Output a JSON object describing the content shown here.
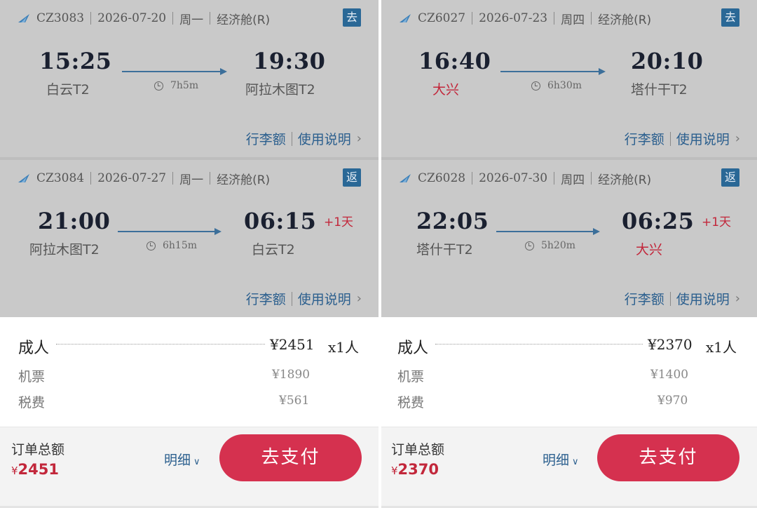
{
  "panels": [
    {
      "flights": [
        {
          "flight_no": "CZ3083",
          "date": "2026-07-20",
          "weekday": "周一",
          "cabin": "经济舱(R)",
          "badge": "去",
          "dep_time": "15:25",
          "dep_place": "白云T2",
          "duration": "7h5m",
          "arr_time": "19:30",
          "arr_place": "阿拉木图T2",
          "plus_day": "",
          "baggage_label": "行李额",
          "usage_label": "使用说明"
        },
        {
          "flight_no": "CZ3084",
          "date": "2026-07-27",
          "weekday": "周一",
          "cabin": "经济舱(R)",
          "badge": "返",
          "dep_time": "21:00",
          "dep_place": "阿拉木图T2",
          "duration": "6h15m",
          "arr_time": "06:15",
          "arr_place": "白云T2",
          "plus_day": "+1天",
          "baggage_label": "行李额",
          "usage_label": "使用说明"
        }
      ],
      "price": {
        "adult_label": "成人",
        "adult_price": "¥2451",
        "adult_count": "x1人",
        "ticket_label": "机票",
        "ticket_price": "¥1890",
        "tax_label": "税费",
        "tax_price": "¥561"
      },
      "bottom": {
        "total_label": "订单总额",
        "currency": "¥",
        "total_amount": "2451",
        "detail_label": "明细",
        "pay_label": "去支付"
      }
    },
    {
      "flights": [
        {
          "flight_no": "CZ6027",
          "date": "2026-07-23",
          "weekday": "周四",
          "cabin": "经济舱(R)",
          "badge": "去",
          "dep_time": "16:40",
          "dep_place": "大兴",
          "duration": "6h30m",
          "arr_time": "20:10",
          "arr_place": "塔什干T2",
          "plus_day": "",
          "baggage_label": "行李额",
          "usage_label": "使用说明"
        },
        {
          "flight_no": "CZ6028",
          "date": "2026-07-30",
          "weekday": "周四",
          "cabin": "经济舱(R)",
          "badge": "返",
          "dep_time": "22:05",
          "dep_place": "塔什干T2",
          "duration": "5h20m",
          "arr_time": "06:25",
          "arr_place": "大兴",
          "plus_day": "+1天",
          "baggage_label": "行李额",
          "usage_label": "使用说明"
        }
      ],
      "price": {
        "adult_label": "成人",
        "adult_price": "¥2370",
        "adult_count": "x1人",
        "ticket_label": "机票",
        "ticket_price": "¥1400",
        "tax_label": "税费",
        "tax_price": "¥970"
      },
      "bottom": {
        "total_label": "订单总额",
        "currency": "¥",
        "total_amount": "2370",
        "detail_label": "明细",
        "pay_label": "去支付"
      }
    }
  ],
  "colors": {
    "accent_blue": "#2b5f8e",
    "badge_blue": "#2a6896",
    "highlight_red": "#c2273b",
    "pay_button": "#d5314f"
  },
  "icons": {
    "airline": "china-southern-logo-icon",
    "clock": "clock-icon",
    "chevron": "chevron-right-icon",
    "caret": "chevron-down-icon"
  }
}
